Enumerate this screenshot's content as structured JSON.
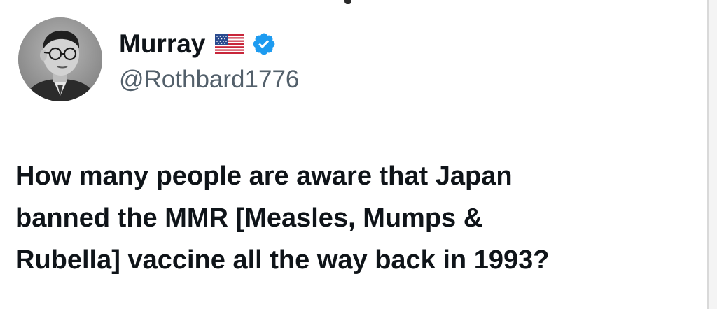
{
  "author": {
    "display_name": "Murray",
    "handle": "@Rothbard1776",
    "avatar_icon": "portrait-avatar",
    "flag_icon": "us-flag-icon",
    "verified_icon": "verified-badge-icon",
    "verified_color": "#1d9bf0"
  },
  "tweet": {
    "lines": [
      "How many people are aware that Japan",
      "banned the MMR [Measles, Mumps &",
      "Rubella] vaccine all the way back in 1993?"
    ]
  },
  "colors": {
    "background": "#ffffff",
    "text": "#0f1419",
    "handle": "#53606b"
  }
}
